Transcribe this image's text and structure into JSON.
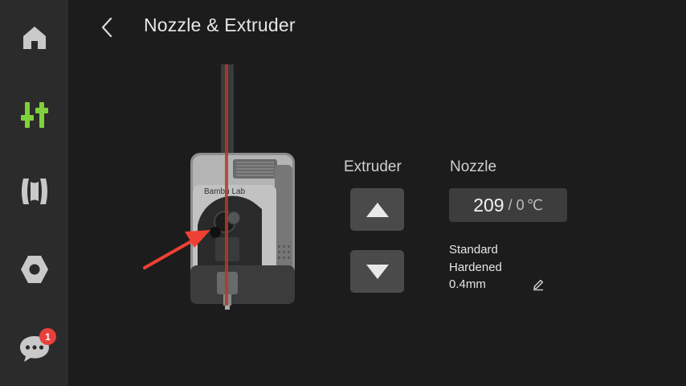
{
  "header": {
    "title": "Nozzle & Extruder"
  },
  "sidebar": {
    "items": [
      {
        "name": "home-icon"
      },
      {
        "name": "controls-icon",
        "active": true
      },
      {
        "name": "filament-icon"
      },
      {
        "name": "settings-icon"
      },
      {
        "name": "messages-icon",
        "badge": "1"
      }
    ]
  },
  "extruder": {
    "label": "Extruder",
    "brand_text": "Bambu Lab"
  },
  "nozzle": {
    "label": "Nozzle",
    "current_temp": "209",
    "separator": "/",
    "target_temp": "0",
    "unit": "℃",
    "type_line1": "Standard",
    "type_line2": "Hardened",
    "diameter": "0.4mm"
  },
  "colors": {
    "accent": "#7fd13b",
    "sidebar_bg": "#2b2b2b",
    "page_bg": "#1c1c1c",
    "button_bg": "#4a4a4a",
    "badge": "#e8413d",
    "arrow": "#ef4035"
  }
}
